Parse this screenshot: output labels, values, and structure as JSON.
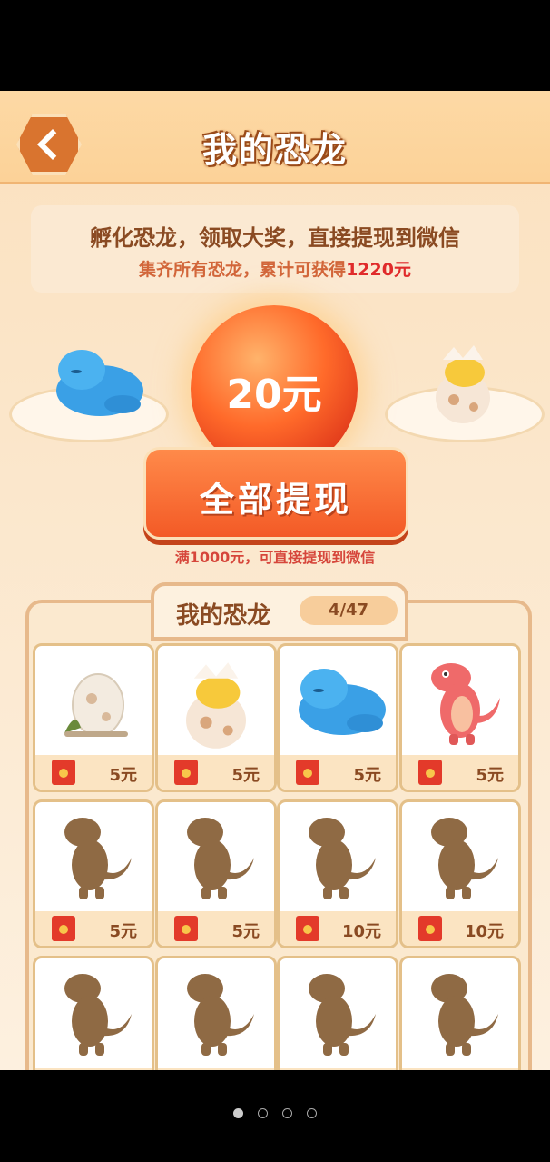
{
  "header": {
    "title": "我的恐龙"
  },
  "info": {
    "line1": "孵化恐龙，领取大奖，直接提现到微信",
    "line2_prefix": "集齐所有恐龙，累计可获得",
    "line2_amount": "1220元"
  },
  "balance": {
    "label": "20元"
  },
  "withdraw": {
    "label": "全部提现",
    "hint": "满1000元，可直接提现到微信"
  },
  "collection": {
    "title": "我的恐龙",
    "progress": "4/47",
    "cards": [
      {
        "name": "egg",
        "price": "5元",
        "unlocked": true
      },
      {
        "name": "hatching-egg",
        "price": "5元",
        "unlocked": true
      },
      {
        "name": "blue-dino",
        "price": "5元",
        "unlocked": true
      },
      {
        "name": "red-dino",
        "price": "5元",
        "unlocked": true
      },
      {
        "name": "locked-dino",
        "price": "5元",
        "unlocked": false
      },
      {
        "name": "locked-dino",
        "price": "5元",
        "unlocked": false
      },
      {
        "name": "locked-dino",
        "price": "10元",
        "unlocked": false
      },
      {
        "name": "locked-dino",
        "price": "10元",
        "unlocked": false
      },
      {
        "name": "locked-dino",
        "price": "",
        "unlocked": false
      },
      {
        "name": "locked-dino",
        "price": "",
        "unlocked": false
      },
      {
        "name": "locked-dino",
        "price": "",
        "unlocked": false
      },
      {
        "name": "locked-dino",
        "price": "",
        "unlocked": false
      }
    ]
  },
  "pager": {
    "count": 4,
    "active": 0
  }
}
